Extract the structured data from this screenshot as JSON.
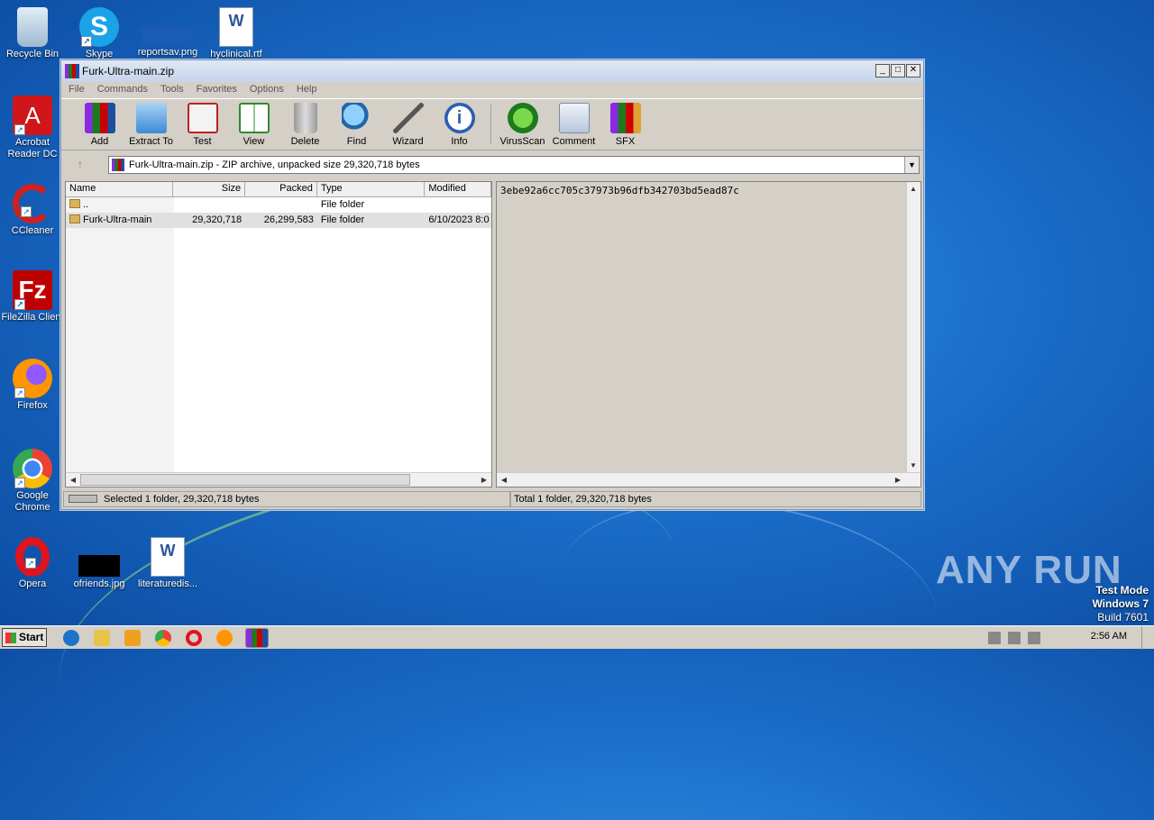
{
  "desktop": {
    "icons": [
      {
        "label": "Recycle Bin"
      },
      {
        "label": "Skype"
      },
      {
        "label": "reportsav.png"
      },
      {
        "label": "hyclinical.rtf"
      },
      {
        "label": "Acrobat Reader DC"
      },
      {
        "label": "CCleaner"
      },
      {
        "label": "FileZilla Client"
      },
      {
        "label": "Firefox"
      },
      {
        "label": "Google Chrome"
      },
      {
        "label": "Opera"
      },
      {
        "label": "ofriends.jpg"
      },
      {
        "label": "literaturedis..."
      }
    ]
  },
  "window": {
    "title": "Furk-Ultra-main.zip",
    "menu": [
      "File",
      "Commands",
      "Tools",
      "Favorites",
      "Options",
      "Help"
    ],
    "toolbar": [
      {
        "label": "Add",
        "icon": "add-archive-icon"
      },
      {
        "label": "Extract To",
        "icon": "extract-folder-icon"
      },
      {
        "label": "Test",
        "icon": "test-clipboard-icon"
      },
      {
        "label": "View",
        "icon": "view-book-icon"
      },
      {
        "label": "Delete",
        "icon": "trash-icon"
      },
      {
        "label": "Find",
        "icon": "magnifier-icon"
      },
      {
        "label": "Wizard",
        "icon": "magic-wand-icon"
      },
      {
        "label": "Info",
        "icon": "info-icon"
      },
      {
        "label": "VirusScan",
        "icon": "bug-scan-icon"
      },
      {
        "label": "Comment",
        "icon": "comment-icon"
      },
      {
        "label": "SFX",
        "icon": "sfx-books-icon"
      }
    ],
    "address": "Furk-Ultra-main.zip - ZIP archive, unpacked size 29,320,718 bytes",
    "columns": [
      "Name",
      "Size",
      "Packed",
      "Type",
      "Modified"
    ],
    "rows": [
      {
        "name": "..",
        "size": "",
        "packed": "",
        "type": "File folder",
        "modified": ""
      },
      {
        "name": "Furk-Ultra-main",
        "size": "29,320,718",
        "packed": "26,299,583",
        "type": "File folder",
        "modified": "6/10/2023 8:0"
      }
    ],
    "comment": "3ebe92a6cc705c37973b96dfb342703bd5ead87c",
    "status_left": "Selected 1 folder, 29,320,718 bytes",
    "status_right": "Total 1 folder, 29,320,718 bytes"
  },
  "watermark": "ANY RUN",
  "testmode": {
    "line1": "Test Mode",
    "line2": "Windows 7",
    "line3": "Build 7601"
  },
  "taskbar": {
    "start": "Start",
    "clock": "2:56 AM"
  }
}
